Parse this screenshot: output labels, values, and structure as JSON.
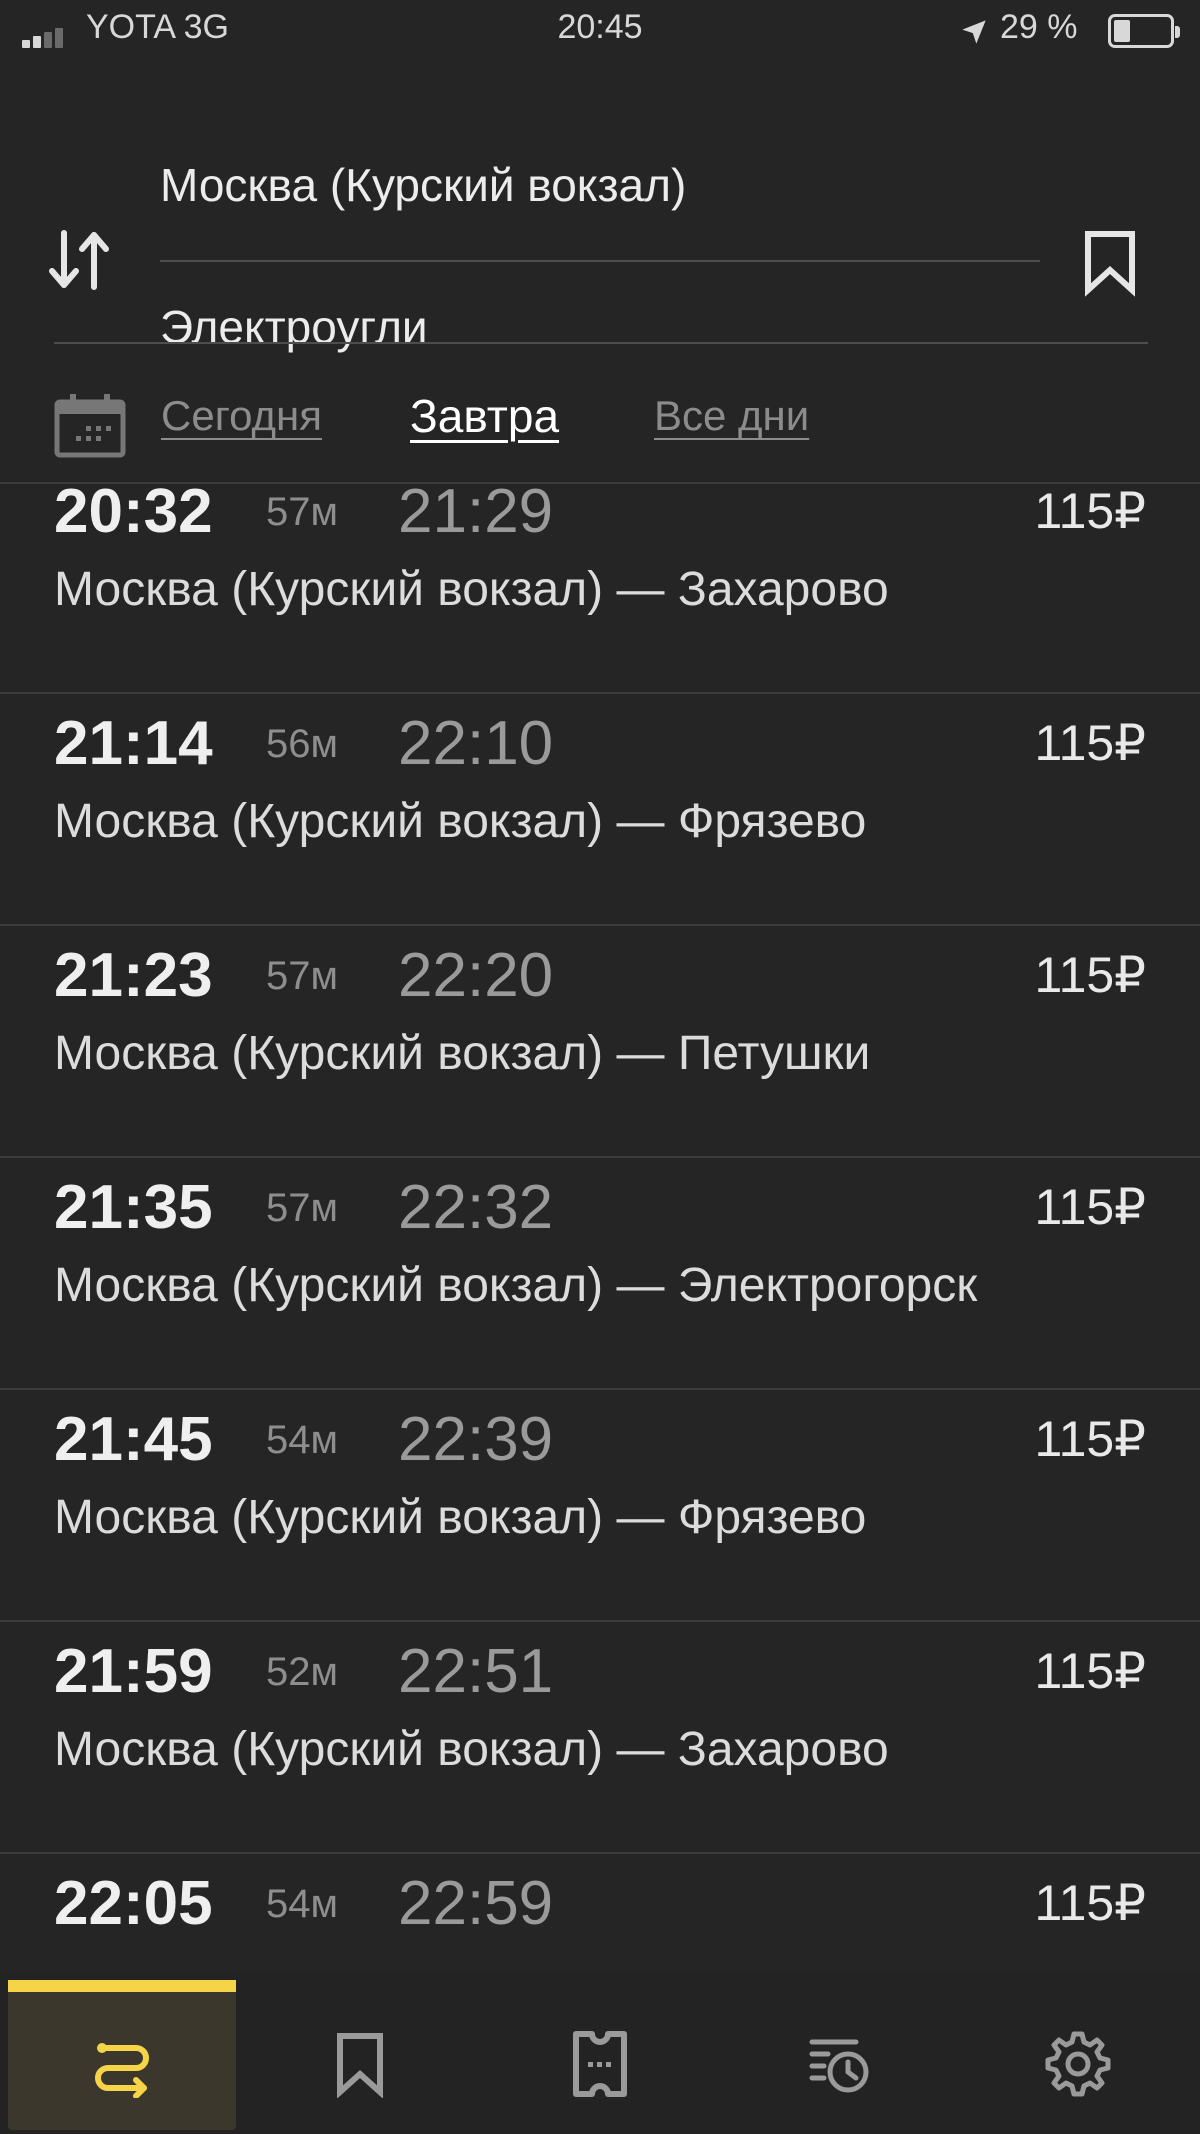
{
  "status_bar": {
    "carrier": "YOTA 3G",
    "time": "20:45",
    "battery": "29 %",
    "battery_level": 0.29
  },
  "route": {
    "from": "Москва (Курский вокзал)",
    "to": "Электроугли"
  },
  "date_tabs": [
    {
      "label": "Сегодня",
      "active": false
    },
    {
      "label": "Завтра",
      "active": true
    },
    {
      "label": "Все дни",
      "active": false
    }
  ],
  "trips": [
    {
      "departure": "20:32",
      "duration": "57м",
      "arrival": "21:29",
      "price": "115₽",
      "route": "Москва (Курский вокзал) — Захарово"
    },
    {
      "departure": "21:14",
      "duration": "56м",
      "arrival": "22:10",
      "price": "115₽",
      "route": "Москва (Курский вокзал) — Фрязево"
    },
    {
      "departure": "21:23",
      "duration": "57м",
      "arrival": "22:20",
      "price": "115₽",
      "route": "Москва (Курский вокзал) — Петушки"
    },
    {
      "departure": "21:35",
      "duration": "57м",
      "arrival": "22:32",
      "price": "115₽",
      "route": "Москва (Курский вокзал) — Электрогорск"
    },
    {
      "departure": "21:45",
      "duration": "54м",
      "arrival": "22:39",
      "price": "115₽",
      "route": "Москва (Курский вокзал) — Фрязево"
    },
    {
      "departure": "21:59",
      "duration": "52м",
      "arrival": "22:51",
      "price": "115₽",
      "route": "Москва (Курский вокзал) — Захарово"
    },
    {
      "departure": "22:05",
      "duration": "54м",
      "arrival": "22:59",
      "price": "115₽",
      "route": ""
    }
  ],
  "tab_bar": [
    {
      "icon": "route-icon",
      "active": true
    },
    {
      "icon": "bookmark-icon",
      "active": false
    },
    {
      "icon": "ticket-icon",
      "active": false
    },
    {
      "icon": "history-icon",
      "active": false
    },
    {
      "icon": "settings-icon",
      "active": false
    }
  ],
  "colors": {
    "background": "#252525",
    "accent": "#f5d547",
    "text_primary": "#efefef",
    "text_secondary": "#8e8e8e"
  }
}
